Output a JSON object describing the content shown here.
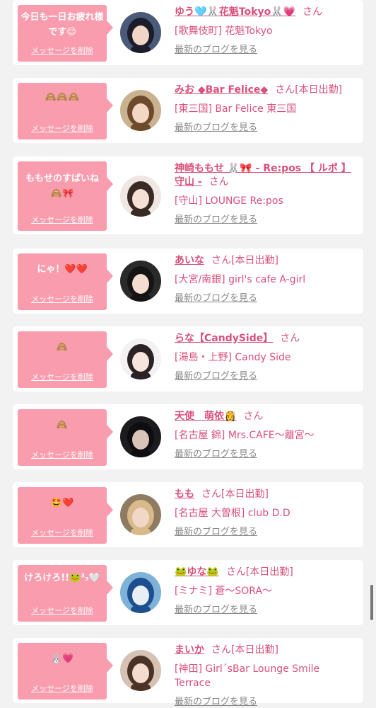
{
  "common": {
    "delete_label": "メッセージを削除",
    "blog_label": "最新のブログを見る",
    "san": "さん"
  },
  "colors": {
    "bubble": "#f89cae",
    "accent": "#d9507a",
    "muted": "#888888",
    "background": "#f2f2f2"
  },
  "entries": [
    {
      "message": "今日も一日お疲れ様です😌",
      "name": "ゆう🩵🐰花魁Tokyo🐰💗",
      "status": "",
      "shop": "[歌舞伎町] 花魁Tokyo",
      "avatar": {
        "bg": "#4a5a78",
        "hair": "#1b1d2a",
        "face": "#f1d5c6"
      }
    },
    {
      "message": "🙈🙈🙈",
      "name": "みお ◆Bar Felice◆",
      "status": "[本日出勤]",
      "shop": "[東三国] Bar Felice 東三国",
      "avatar": {
        "bg": "#c9b28f",
        "hair": "#6d4a2c",
        "face": "#f2d8c4"
      }
    },
    {
      "message": "ももせのすぱいね🙈🎀",
      "name": "神崎ももせ 🐰🎀 - Re:pos 【 ルポ 】守山 -",
      "status": "",
      "shop": "[守山] LOUNGE Re:pos",
      "avatar": {
        "bg": "#f0e6e4",
        "hair": "#3a2a26",
        "face": "#f6e0d6"
      }
    },
    {
      "message": "にゃ！❤️❤️",
      "name": "あいな",
      "status": "[本日出勤]",
      "shop": "[大宮/南銀] girl's cafe A-girl",
      "avatar": {
        "bg": "#2a2a2a",
        "hair": "#141414",
        "face": "#f4dcd0"
      }
    },
    {
      "message": "🙈",
      "name": "らな【CandySide】",
      "status": "",
      "shop": "[湯島・上野] Candy Side",
      "avatar": {
        "bg": "#f3f1f2",
        "hair": "#2b2224",
        "face": "#f7e4dc"
      }
    },
    {
      "message": "🙈",
      "name": "天使　萌依👸",
      "status": "",
      "shop": "[名古屋 錦] Mrs.CAFE〜離宮〜",
      "avatar": {
        "bg": "#1c1c20",
        "hair": "#0e0e10",
        "face": "#d9c4bb"
      }
    },
    {
      "message": "🤩❤️",
      "name": "もも",
      "status": "[本日出勤]",
      "shop": "[名古屋 大曽根] club D.D",
      "avatar": {
        "bg": "#8f7a62",
        "hair": "#d8b98a",
        "face": "#f1d7c6"
      }
    },
    {
      "message": "けろけろ!!🐸³₃🤍",
      "name": "🐸ゆな🐸",
      "status": "[本日出勤]",
      "shop": "[ミナミ] 蒼〜SORA〜",
      "avatar": {
        "bg": "#7fb2d8",
        "hair": "#1d4f8e",
        "face": "#e9eef4"
      }
    },
    {
      "message": "🐰💗",
      "name": "まいか",
      "status": "[本日出勤]",
      "shop": "[神田] Girl´sBar Lounge Smile Terrace",
      "avatar": {
        "bg": "#d6c2b4",
        "hair": "#4a3326",
        "face": "#f3dccd"
      }
    }
  ]
}
